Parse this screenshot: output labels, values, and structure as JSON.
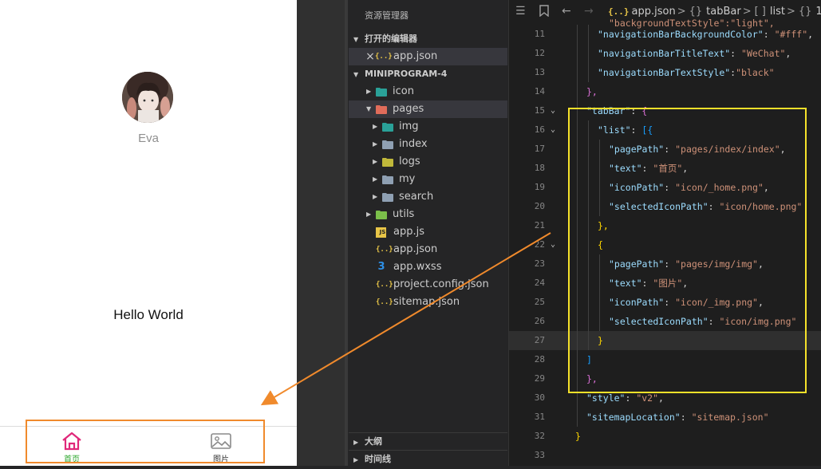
{
  "simulator": {
    "nickname": "Eva",
    "motto": "Hello World",
    "tabbar": [
      {
        "text": "首页",
        "color": "#2aa52a",
        "icon_color": "#e0287a",
        "icon": "home-icon"
      },
      {
        "text": "图片",
        "color": "#333333",
        "icon_color": "#8a8a8a",
        "icon": "image-icon"
      }
    ]
  },
  "explorer": {
    "title": "资源管理器",
    "open_editors_header": "打开的编辑器",
    "open_editors": [
      {
        "name": "app.json",
        "icon": "json-icon",
        "close_glyph": "×",
        "json_glyph": "{..}"
      }
    ],
    "project_header": "MINIPROGRAM-4",
    "tree": [
      {
        "name": "icon",
        "type": "folder",
        "depth": 1,
        "expanded": false,
        "icon_color": "#2aa198"
      },
      {
        "name": "pages",
        "type": "folder",
        "depth": 1,
        "expanded": true,
        "icon_color": "#e06c5a",
        "selected": true
      },
      {
        "name": "img",
        "type": "folder",
        "depth": 2,
        "expanded": false,
        "icon_color": "#2aa198"
      },
      {
        "name": "index",
        "type": "folder",
        "depth": 2,
        "expanded": false,
        "icon_color": "#8fa0b3"
      },
      {
        "name": "logs",
        "type": "folder",
        "depth": 2,
        "expanded": false,
        "icon_color": "#c0b83a"
      },
      {
        "name": "my",
        "type": "folder",
        "depth": 2,
        "expanded": false,
        "icon_color": "#8fa0b3"
      },
      {
        "name": "search",
        "type": "folder",
        "depth": 2,
        "expanded": false,
        "icon_color": "#8fa0b3"
      },
      {
        "name": "utils",
        "type": "folder",
        "depth": 1,
        "expanded": false,
        "icon_color": "#7bbf4a"
      },
      {
        "name": "app.js",
        "type": "js",
        "depth": 1,
        "glyph": "JS",
        "icon_color": "#e8c547"
      },
      {
        "name": "app.json",
        "type": "json",
        "depth": 1,
        "glyph": "{..}",
        "icon_color": "#e8c547"
      },
      {
        "name": "app.wxss",
        "type": "css",
        "depth": 1,
        "glyph": "3",
        "icon_color": "#2d8fe6"
      },
      {
        "name": "project.config.json",
        "type": "json",
        "depth": 1,
        "glyph": "{..}",
        "icon_color": "#e8c547"
      },
      {
        "name": "sitemap.json",
        "type": "json",
        "depth": 1,
        "glyph": "{..}",
        "icon_color": "#e8c547"
      }
    ],
    "bottom_sections": [
      "大纲",
      "时间线"
    ]
  },
  "editor": {
    "breadcrumb": [
      {
        "text": "app.json",
        "prefix": "{..}"
      },
      {
        "text": "tabBar",
        "prefix": "{}"
      },
      {
        "text": "list",
        "prefix": "[ ]"
      },
      {
        "text": "1",
        "prefix": "{}"
      }
    ],
    "breadcrumb_sep": ">",
    "top_partial_text": "\"backgroundTextStyle\":\"light\",",
    "lines": [
      {
        "n": "11",
        "indent": 2,
        "key": "\"navigationBarBackgroundColor\"",
        "sep": ": ",
        "val": "\"#fff\"",
        "tail": ","
      },
      {
        "n": "12",
        "indent": 2,
        "key": "\"navigationBarTitleText\"",
        "sep": ": ",
        "val": "\"WeChat\"",
        "tail": ","
      },
      {
        "n": "13",
        "indent": 2,
        "key": "\"navigationBarTextStyle\"",
        "sep": ":",
        "val": "\"black\"",
        "tail": ""
      },
      {
        "n": "14",
        "indent": 1,
        "punct": "},",
        "bclass": "br2"
      },
      {
        "n": "15",
        "indent": 1,
        "key": "\"tabBar\"",
        "sep": ": ",
        "punct": "{",
        "bclass": "br2",
        "fold": true
      },
      {
        "n": "16",
        "indent": 2,
        "key": "\"list\"",
        "sep": ": ",
        "punct": "[{",
        "bclass": "br3",
        "fold": true
      },
      {
        "n": "17",
        "indent": 3,
        "key": "\"pagePath\"",
        "sep": ": ",
        "val": "\"pages/index/index\"",
        "tail": ","
      },
      {
        "n": "18",
        "indent": 3,
        "key": "\"text\"",
        "sep": ": ",
        "val": "\"首页\"",
        "tail": ","
      },
      {
        "n": "19",
        "indent": 3,
        "key": "\"iconPath\"",
        "sep": ": ",
        "val": "\"icon/_home.png\"",
        "tail": ","
      },
      {
        "n": "20",
        "indent": 3,
        "key": "\"selectedIconPath\"",
        "sep": ": ",
        "val": "\"icon/home.png\"",
        "tail": ""
      },
      {
        "n": "21",
        "indent": 2,
        "punct": "},",
        "bclass": "br1"
      },
      {
        "n": "22",
        "indent": 2,
        "punct": "{",
        "bclass": "br1",
        "fold": true
      },
      {
        "n": "23",
        "indent": 3,
        "key": "\"pagePath\"",
        "sep": ": ",
        "val": "\"pages/img/img\"",
        "tail": ","
      },
      {
        "n": "24",
        "indent": 3,
        "key": "\"text\"",
        "sep": ": ",
        "val": "\"图片\"",
        "tail": ","
      },
      {
        "n": "25",
        "indent": 3,
        "key": "\"iconPath\"",
        "sep": ": ",
        "val": "\"icon/_img.png\"",
        "tail": ","
      },
      {
        "n": "26",
        "indent": 3,
        "key": "\"selectedIconPath\"",
        "sep": ": ",
        "val": "\"icon/img.png\"",
        "tail": ""
      },
      {
        "n": "27",
        "indent": 2,
        "punct": "}",
        "bclass": "br1",
        "current": true
      },
      {
        "n": "28",
        "indent": 1,
        "punct": "]",
        "bclass": "br3"
      },
      {
        "n": "29",
        "indent": 1,
        "punct": "},",
        "bclass": "br2"
      },
      {
        "n": "30",
        "indent": 1,
        "key": "\"style\"",
        "sep": ": ",
        "val": "\"v2\"",
        "tail": ","
      },
      {
        "n": "31",
        "indent": 1,
        "key": "\"sitemapLocation\"",
        "sep": ": ",
        "val": "\"sitemap.json\"",
        "tail": ""
      },
      {
        "n": "32",
        "indent": 0,
        "punct": "}",
        "bclass": "br1"
      },
      {
        "n": "33",
        "indent": 0,
        "punct": ""
      }
    ]
  },
  "colors": {
    "highlight_box": "#f5e12a",
    "annotation_orange": "#f08a2c"
  }
}
